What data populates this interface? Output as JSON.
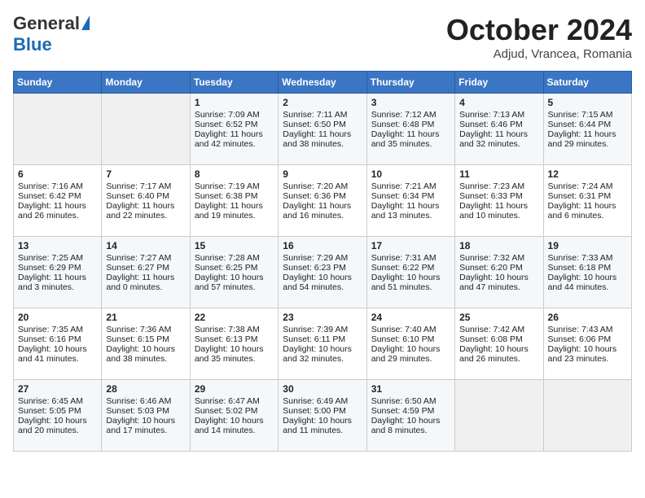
{
  "logo": {
    "general": "General",
    "blue": "Blue"
  },
  "title": "October 2024",
  "location": "Adjud, Vrancea, Romania",
  "days_of_week": [
    "Sunday",
    "Monday",
    "Tuesday",
    "Wednesday",
    "Thursday",
    "Friday",
    "Saturday"
  ],
  "weeks": [
    [
      {
        "day": "",
        "info": ""
      },
      {
        "day": "",
        "info": ""
      },
      {
        "day": "1",
        "info": "Sunrise: 7:09 AM\nSunset: 6:52 PM\nDaylight: 11 hours and 42 minutes."
      },
      {
        "day": "2",
        "info": "Sunrise: 7:11 AM\nSunset: 6:50 PM\nDaylight: 11 hours and 38 minutes."
      },
      {
        "day": "3",
        "info": "Sunrise: 7:12 AM\nSunset: 6:48 PM\nDaylight: 11 hours and 35 minutes."
      },
      {
        "day": "4",
        "info": "Sunrise: 7:13 AM\nSunset: 6:46 PM\nDaylight: 11 hours and 32 minutes."
      },
      {
        "day": "5",
        "info": "Sunrise: 7:15 AM\nSunset: 6:44 PM\nDaylight: 11 hours and 29 minutes."
      }
    ],
    [
      {
        "day": "6",
        "info": "Sunrise: 7:16 AM\nSunset: 6:42 PM\nDaylight: 11 hours and 26 minutes."
      },
      {
        "day": "7",
        "info": "Sunrise: 7:17 AM\nSunset: 6:40 PM\nDaylight: 11 hours and 22 minutes."
      },
      {
        "day": "8",
        "info": "Sunrise: 7:19 AM\nSunset: 6:38 PM\nDaylight: 11 hours and 19 minutes."
      },
      {
        "day": "9",
        "info": "Sunrise: 7:20 AM\nSunset: 6:36 PM\nDaylight: 11 hours and 16 minutes."
      },
      {
        "day": "10",
        "info": "Sunrise: 7:21 AM\nSunset: 6:34 PM\nDaylight: 11 hours and 13 minutes."
      },
      {
        "day": "11",
        "info": "Sunrise: 7:23 AM\nSunset: 6:33 PM\nDaylight: 11 hours and 10 minutes."
      },
      {
        "day": "12",
        "info": "Sunrise: 7:24 AM\nSunset: 6:31 PM\nDaylight: 11 hours and 6 minutes."
      }
    ],
    [
      {
        "day": "13",
        "info": "Sunrise: 7:25 AM\nSunset: 6:29 PM\nDaylight: 11 hours and 3 minutes."
      },
      {
        "day": "14",
        "info": "Sunrise: 7:27 AM\nSunset: 6:27 PM\nDaylight: 11 hours and 0 minutes."
      },
      {
        "day": "15",
        "info": "Sunrise: 7:28 AM\nSunset: 6:25 PM\nDaylight: 10 hours and 57 minutes."
      },
      {
        "day": "16",
        "info": "Sunrise: 7:29 AM\nSunset: 6:23 PM\nDaylight: 10 hours and 54 minutes."
      },
      {
        "day": "17",
        "info": "Sunrise: 7:31 AM\nSunset: 6:22 PM\nDaylight: 10 hours and 51 minutes."
      },
      {
        "day": "18",
        "info": "Sunrise: 7:32 AM\nSunset: 6:20 PM\nDaylight: 10 hours and 47 minutes."
      },
      {
        "day": "19",
        "info": "Sunrise: 7:33 AM\nSunset: 6:18 PM\nDaylight: 10 hours and 44 minutes."
      }
    ],
    [
      {
        "day": "20",
        "info": "Sunrise: 7:35 AM\nSunset: 6:16 PM\nDaylight: 10 hours and 41 minutes."
      },
      {
        "day": "21",
        "info": "Sunrise: 7:36 AM\nSunset: 6:15 PM\nDaylight: 10 hours and 38 minutes."
      },
      {
        "day": "22",
        "info": "Sunrise: 7:38 AM\nSunset: 6:13 PM\nDaylight: 10 hours and 35 minutes."
      },
      {
        "day": "23",
        "info": "Sunrise: 7:39 AM\nSunset: 6:11 PM\nDaylight: 10 hours and 32 minutes."
      },
      {
        "day": "24",
        "info": "Sunrise: 7:40 AM\nSunset: 6:10 PM\nDaylight: 10 hours and 29 minutes."
      },
      {
        "day": "25",
        "info": "Sunrise: 7:42 AM\nSunset: 6:08 PM\nDaylight: 10 hours and 26 minutes."
      },
      {
        "day": "26",
        "info": "Sunrise: 7:43 AM\nSunset: 6:06 PM\nDaylight: 10 hours and 23 minutes."
      }
    ],
    [
      {
        "day": "27",
        "info": "Sunrise: 6:45 AM\nSunset: 5:05 PM\nDaylight: 10 hours and 20 minutes."
      },
      {
        "day": "28",
        "info": "Sunrise: 6:46 AM\nSunset: 5:03 PM\nDaylight: 10 hours and 17 minutes."
      },
      {
        "day": "29",
        "info": "Sunrise: 6:47 AM\nSunset: 5:02 PM\nDaylight: 10 hours and 14 minutes."
      },
      {
        "day": "30",
        "info": "Sunrise: 6:49 AM\nSunset: 5:00 PM\nDaylight: 10 hours and 11 minutes."
      },
      {
        "day": "31",
        "info": "Sunrise: 6:50 AM\nSunset: 4:59 PM\nDaylight: 10 hours and 8 minutes."
      },
      {
        "day": "",
        "info": ""
      },
      {
        "day": "",
        "info": ""
      }
    ]
  ]
}
